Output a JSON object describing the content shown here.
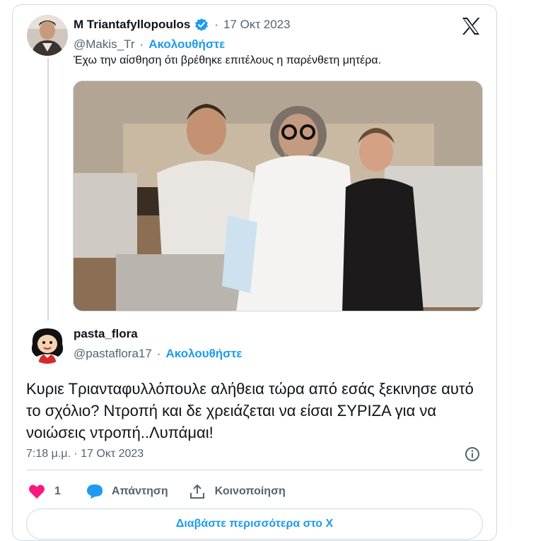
{
  "tweet": {
    "author_name": "M Triantafyllopoulos",
    "separator": "·",
    "date": "17 Οκτ 2023",
    "handle": "@Makis_Tr",
    "follow_label": "Ακολουθήστε",
    "text": "Έχω την αίσθηση ότι βρέθηκε επιτέλους η παρένθετη μητέρα."
  },
  "reply": {
    "author_name": "pasta_flora",
    "handle": "@pastaflora17",
    "separator": "·",
    "follow_label": "Ακολουθήστε",
    "text": "Κυριε Τριανταφυλλόπουλε αλήθεια τώρα από εσάς ξεκινησε αυτό το σχόλιο? Ντροπή και δε χρειάζεται να είσαι ΣΥΡΙΖΑ για να νοιώσεις ντροπή..Λυπάμαι!",
    "timestamp": "7:18 μ.μ. · 17 Οκτ 2023"
  },
  "actions": {
    "like_count": "1",
    "reply_label": "Απάντηση",
    "share_label": "Κοινοποίηση"
  },
  "read_more_label": "Διαβάστε περισσότερα στο X",
  "icons": {
    "x_logo": "x-logo-icon",
    "verified": "verified-badge-icon",
    "info": "info-icon",
    "heart": "heart-icon",
    "reply": "reply-bubble-icon",
    "share": "share-upload-icon"
  },
  "colors": {
    "accent": "#1d9bf0",
    "heart": "#f91880",
    "muted": "#536471",
    "border": "#cfd9de"
  }
}
